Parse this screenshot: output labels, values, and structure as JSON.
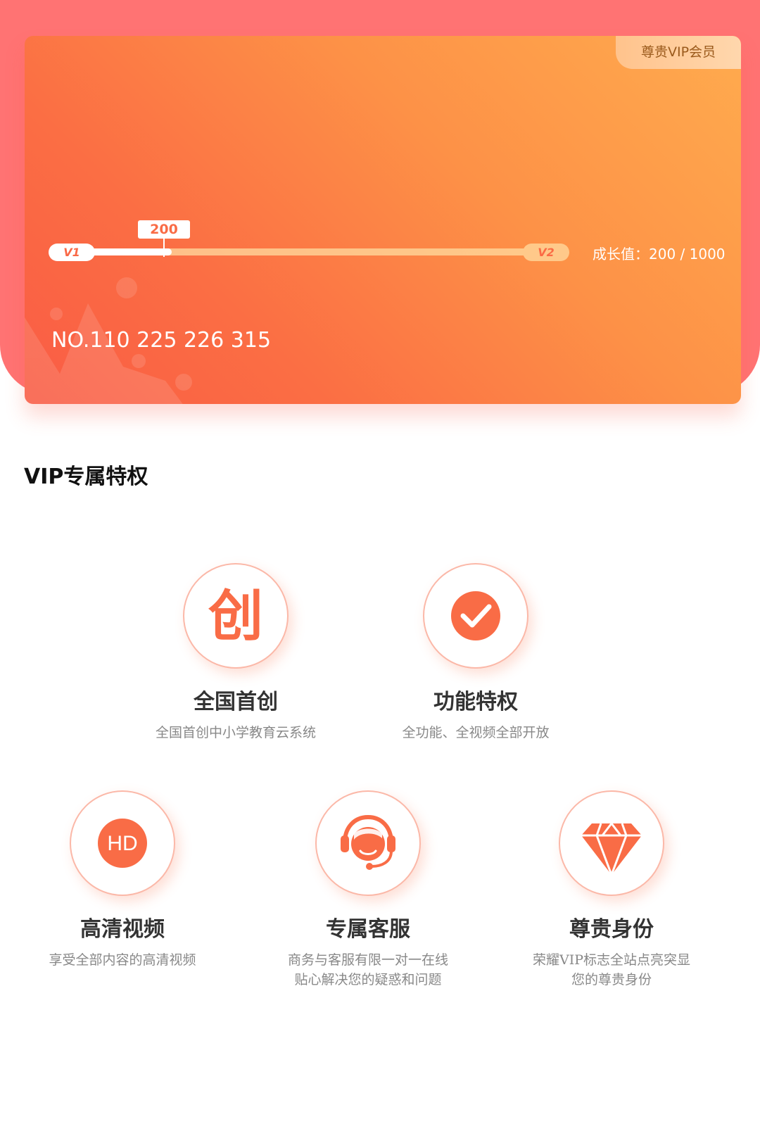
{
  "card": {
    "badge": "尊贵VIP会员",
    "current_value_label": "200",
    "level_start": "V1",
    "level_end": "V2",
    "growth_text": "成长值：200 / 1000",
    "growth_current": 200,
    "growth_max": 1000,
    "member_no": "NO.110 225 226 315"
  },
  "section": {
    "title": "VIP专属特权"
  },
  "features": [
    {
      "icon": "chuang-character-icon",
      "icon_text": "创",
      "title": "全国首创",
      "desc": [
        "全国首创中小学教育云系统"
      ]
    },
    {
      "icon": "check-circle-icon",
      "title": "功能特权",
      "desc": [
        "全功能、全视频全部开放"
      ]
    },
    {
      "icon": "hd-icon",
      "icon_text": "HD",
      "title": "高清视频",
      "desc": [
        "享受全部内容的高清视频"
      ]
    },
    {
      "icon": "customer-service-headset-icon",
      "title": "专属客服",
      "desc": [
        "商务与客服有限一对一在线",
        "贴心解决您的疑惑和问题"
      ]
    },
    {
      "icon": "diamond-icon",
      "title": "尊贵身份",
      "desc": [
        "荣耀VIP标志全站点亮突显",
        "您的尊贵身份"
      ]
    }
  ],
  "colors": {
    "accent": "#f96c46",
    "card_gradient_start": "#ffab4e",
    "card_gradient_end": "#f95c45",
    "header_bg": "#ff7373"
  }
}
